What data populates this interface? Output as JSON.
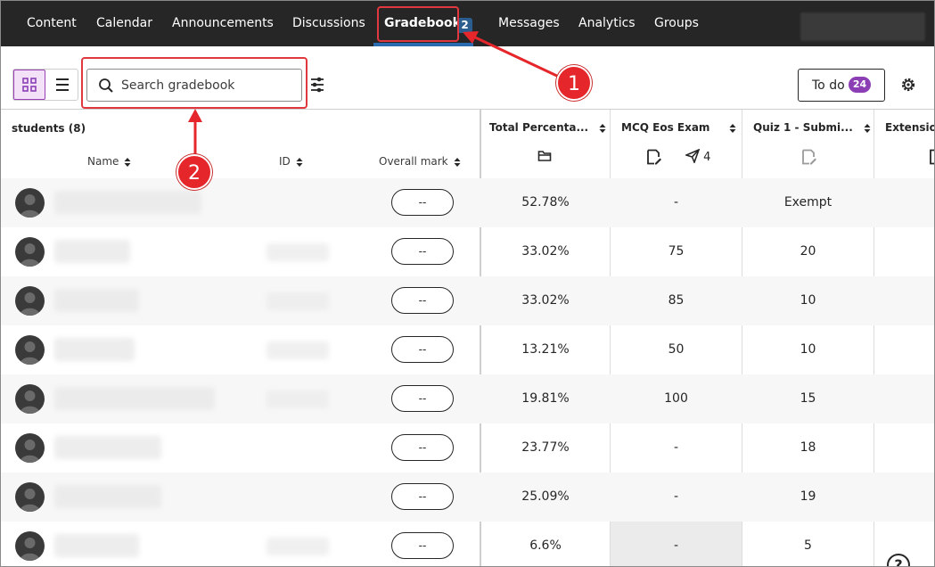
{
  "nav": {
    "items": [
      {
        "label": "Content",
        "active": false
      },
      {
        "label": "Calendar",
        "active": false
      },
      {
        "label": "Announcements",
        "active": false
      },
      {
        "label": "Discussions",
        "active": false
      },
      {
        "label": "Gradebook",
        "active": true
      },
      {
        "label": "Messages",
        "active": false
      },
      {
        "label": "Analytics",
        "active": false
      },
      {
        "label": "Groups",
        "active": false
      }
    ],
    "gradebook_badge": "2"
  },
  "toolbar": {
    "search_placeholder": "Search gradebook",
    "todo_label": "To do",
    "todo_count": "24"
  },
  "callouts": [
    "1",
    "2"
  ],
  "table": {
    "students_label": "students (8)",
    "sub_headers": {
      "name": "Name",
      "id": "ID",
      "overall": "Overall mark"
    },
    "columns": [
      {
        "title": "Total Percenta...",
        "icon": "folder-icon"
      },
      {
        "title": "MCQ Eos Exam",
        "icon": "document-edit-icon",
        "needs_grading": "4"
      },
      {
        "title": "Quiz 1 - Submi...",
        "icon": "document-edit-icon"
      },
      {
        "title": "Extension",
        "icon": "document-edit-icon"
      }
    ],
    "rows": [
      {
        "overall": "--",
        "total": "52.78%",
        "mcq": "-",
        "quiz": "Exempt"
      },
      {
        "overall": "--",
        "total": "33.02%",
        "mcq": "75",
        "quiz": "20"
      },
      {
        "overall": "--",
        "total": "33.02%",
        "mcq": "85",
        "quiz": "10"
      },
      {
        "overall": "--",
        "total": "13.21%",
        "mcq": "50",
        "quiz": "10"
      },
      {
        "overall": "--",
        "total": "19.81%",
        "mcq": "100",
        "quiz": "15"
      },
      {
        "overall": "--",
        "total": "23.77%",
        "mcq": "-",
        "quiz": "18"
      },
      {
        "overall": "--",
        "total": "25.09%",
        "mcq": "-",
        "quiz": "19"
      },
      {
        "overall": "--",
        "total": "6.6%",
        "mcq": "-",
        "quiz": "5"
      }
    ]
  },
  "colors": {
    "nav_bg": "#262626",
    "accent_purple": "#8c3fb5",
    "callout_red": "#e5262b",
    "nav_active_underline": "#2a6bb0"
  },
  "help": "?"
}
